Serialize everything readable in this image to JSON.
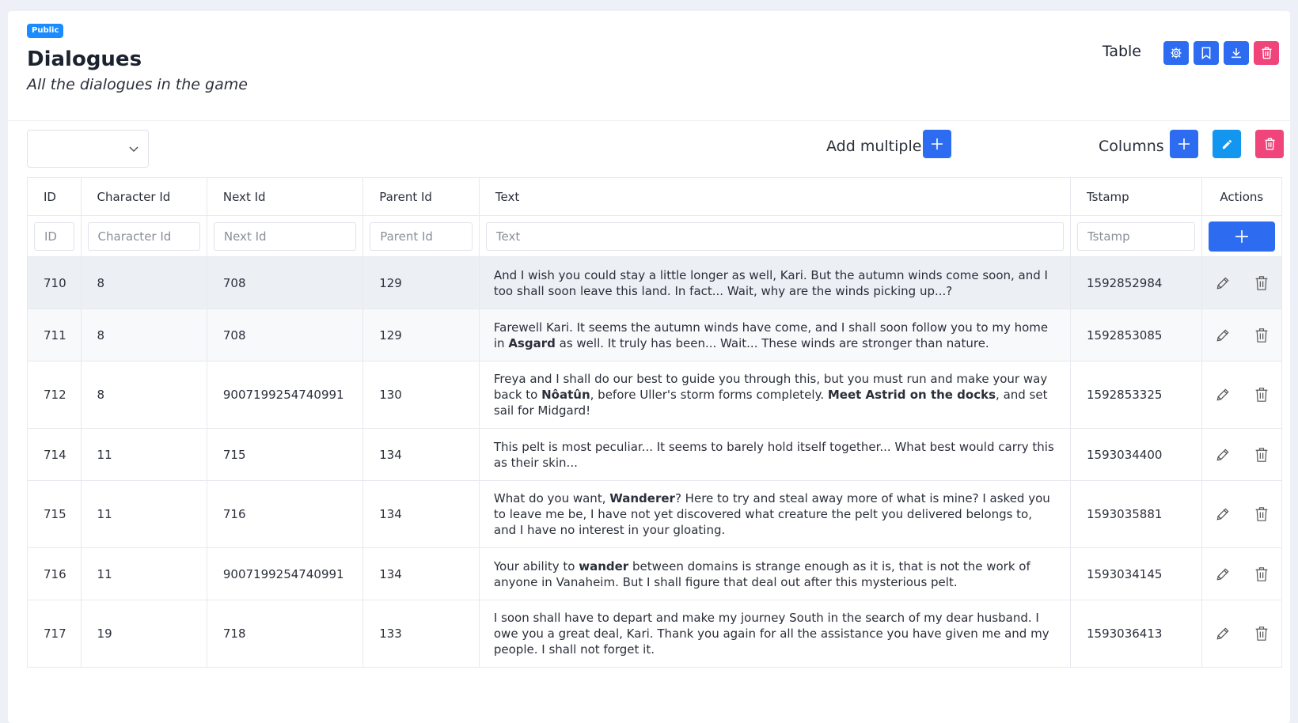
{
  "header": {
    "badge": "Public",
    "title": "Dialogues",
    "subtitle": "All the dialogues in the game",
    "table_label": "Table",
    "buttons": [
      "gear-icon",
      "bookmark-icon",
      "download-icon",
      "trash-icon"
    ]
  },
  "toolbar": {
    "select_value": "",
    "add_multiple_label": "Add multiple",
    "columns_label": "Columns"
  },
  "table": {
    "columns": [
      "ID",
      "Character Id",
      "Next Id",
      "Parent Id",
      "Text",
      "Tstamp",
      "Actions"
    ],
    "filters": [
      "ID",
      "Character Id",
      "Next Id",
      "Parent Id",
      "Text",
      "Tstamp"
    ],
    "rows": [
      {
        "id": "710",
        "character_id": "8",
        "next_id": "708",
        "parent_id": "129",
        "text": "And I wish you could stay a little longer as well, Kari. But the autumn winds come soon, and I too shall soon leave this land. In fact... Wait, why are the winds picking up...?",
        "tstamp": "1592852984"
      },
      {
        "id": "711",
        "character_id": "8",
        "next_id": "708",
        "parent_id": "129",
        "text": "Farewell Kari. It seems the autumn winds have come, and I shall soon follow you to my home in <b>Asgard</b> as well. It truly has been... Wait... These winds are stronger than nature.",
        "tstamp": "1592853085"
      },
      {
        "id": "712",
        "character_id": "8",
        "next_id": "9007199254740991",
        "parent_id": "130",
        "text": "Freya and I shall do our best to guide you through this, but you must run and make your way back to <b>Nôatûn</b>, before Uller's storm forms completely. <b>Meet Astrid on the docks</b>, and set sail for Midgard!",
        "tstamp": "1592853325"
      },
      {
        "id": "714",
        "character_id": "11",
        "next_id": "715",
        "parent_id": "134",
        "text": "This pelt is most peculiar... It seems to barely hold itself together... What best would carry this as their skin...",
        "tstamp": "1593034400"
      },
      {
        "id": "715",
        "character_id": "11",
        "next_id": "716",
        "parent_id": "134",
        "text": "What do you want, <b>Wanderer</b>? Here to try and steal away more of what is mine? I asked you to leave me be, I have not yet discovered what creature the pelt you delivered belongs to, and I have no interest in your gloating.",
        "tstamp": "1593035881"
      },
      {
        "id": "716",
        "character_id": "11",
        "next_id": "9007199254740991",
        "parent_id": "134",
        "text": "Your ability to <b>wander</b> between domains is strange enough as it is, that is not the work of anyone in Vanaheim. But I shall figure that deal out after this mysterious pelt.",
        "tstamp": "1593034145"
      },
      {
        "id": "717",
        "character_id": "19",
        "next_id": "718",
        "parent_id": "133",
        "text": "I soon shall have to depart and make my journey South in the search of my dear husband. I owe you a great deal, Kari. Thank you again for all the assistance you have given me and my people. I shall not forget it.",
        "tstamp": "1593036413"
      }
    ]
  }
}
